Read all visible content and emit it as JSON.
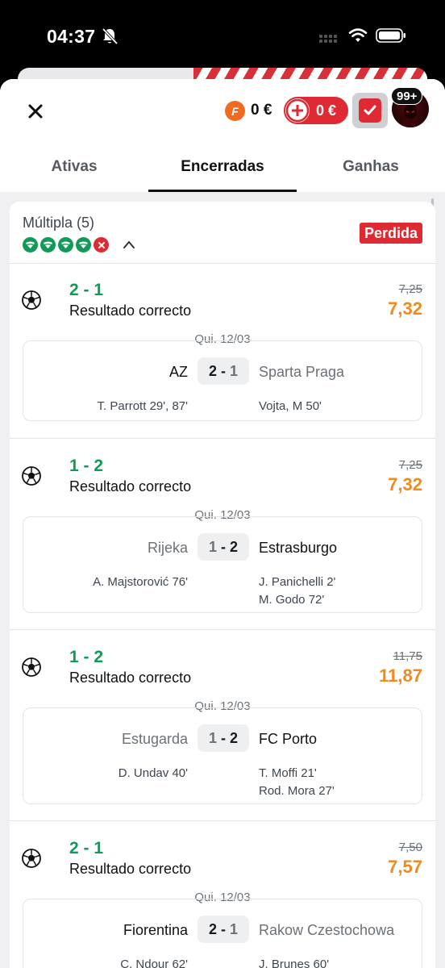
{
  "status_bar": {
    "time": "04:37"
  },
  "header": {
    "coin_letter": "F",
    "coin_amount": "0 €",
    "bonus_amount": "0 €",
    "notifications": "99+"
  },
  "tabs": [
    {
      "label": "Ativas",
      "active": false
    },
    {
      "label": "Encerradas",
      "active": true
    },
    {
      "label": "Ganhas",
      "active": false
    }
  ],
  "multiple": {
    "title": "Múltipla (5)",
    "status": "Perdida",
    "legs": [
      "won",
      "won",
      "won",
      "won",
      "lost"
    ]
  },
  "bets": [
    {
      "pick": "2 - 1",
      "market": "Resultado correcto",
      "old_odds": "7,25",
      "new_odds": "7,32",
      "date": "Qui. 12/03",
      "home": "AZ",
      "away": "Sparta Praga",
      "home_score": "2",
      "away_score": "1",
      "home_scorers": [
        "T. Parrott 29', 87'"
      ],
      "away_scorers": [
        "Vojta, M 50'"
      ]
    },
    {
      "pick": "1 - 2",
      "market": "Resultado correcto",
      "old_odds": "7,25",
      "new_odds": "7,32",
      "date": "Qui. 12/03",
      "home": "Rijeka",
      "away": "Estrasburgo",
      "home_score": "1",
      "away_score": "2",
      "home_scorers": [
        "A. Majstorović 76'"
      ],
      "away_scorers": [
        "J. Panichelli 2'",
        "M. Godo 72'"
      ]
    },
    {
      "pick": "1 - 2",
      "market": "Resultado correcto",
      "old_odds": "11,75",
      "new_odds": "11,87",
      "date": "Qui. 12/03",
      "home": "Estugarda",
      "away": "FC Porto",
      "home_score": "1",
      "away_score": "2",
      "home_scorers": [
        "D. Undav 40'"
      ],
      "away_scorers": [
        "T. Moffi 21'",
        "Rod. Mora 27'"
      ]
    },
    {
      "pick": "2 - 1",
      "market": "Resultado correcto",
      "old_odds": "7,50",
      "new_odds": "7,57",
      "date": "Qui. 12/03",
      "home": "Fiorentina",
      "away": "Rakow Czestochowa",
      "home_score": "2",
      "away_score": "1",
      "home_scorers": [
        "C. Ndour 62'"
      ],
      "away_scorers": [
        "J. Brunes 60'"
      ]
    }
  ],
  "colors": {
    "win_green": "#119a57",
    "lost_red": "#e02a33",
    "odds_orange": "#f08a1c"
  }
}
